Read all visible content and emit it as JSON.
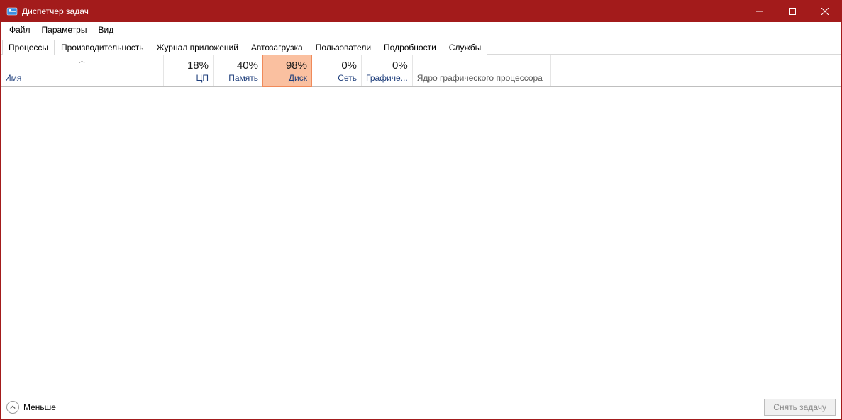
{
  "window": {
    "title": "Диспетчер задач"
  },
  "menu": {
    "file": "Файл",
    "options": "Параметры",
    "view": "Вид"
  },
  "tabs": {
    "processes": "Процессы",
    "performance": "Производительность",
    "apphistory": "Журнал приложений",
    "startup": "Автозагрузка",
    "users": "Пользователи",
    "details": "Подробности",
    "services": "Службы"
  },
  "columns": {
    "name": "Имя",
    "cpu": {
      "pct": "18%",
      "label": "ЦП"
    },
    "memory": {
      "pct": "40%",
      "label": "Память"
    },
    "disk": {
      "pct": "98%",
      "label": "Диск"
    },
    "network": {
      "pct": "0%",
      "label": "Сеть"
    },
    "gpu": {
      "pct": "0%",
      "label": "Графиче..."
    },
    "gpucore": {
      "label": "Ядро графического процессора"
    }
  },
  "footer": {
    "fewer": "Меньше",
    "endtask": "Снять задачу"
  }
}
